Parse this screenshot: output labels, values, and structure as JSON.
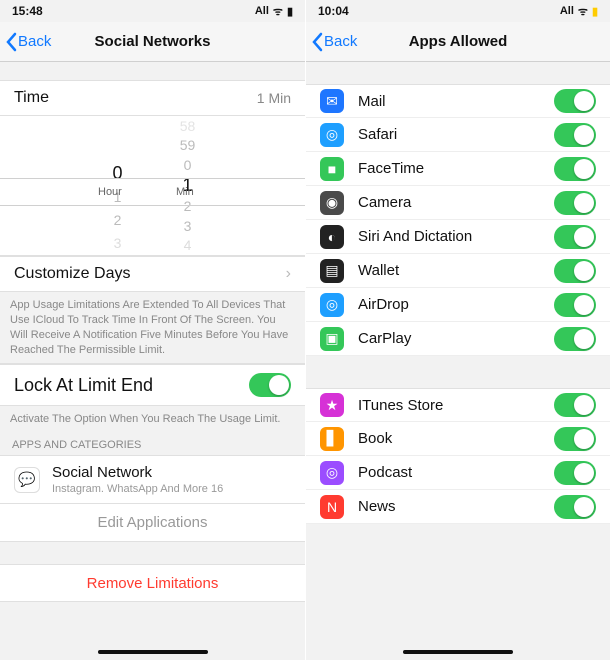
{
  "left": {
    "status": {
      "time": "15:48",
      "carrier": "All"
    },
    "nav": {
      "back": "Back",
      "title": "Social Networks"
    },
    "timeRow": {
      "label": "Time",
      "value": "1 Min"
    },
    "picker": {
      "hours": [
        "",
        "",
        "0",
        "1",
        "2",
        "3"
      ],
      "mins": [
        "58",
        "59",
        "0",
        "1",
        "2",
        "3",
        "4"
      ],
      "selHour": "0",
      "selMin": "1",
      "hourUnit": "Hour",
      "minUnit": "Min"
    },
    "customize": "Customize Days",
    "note1": "App Usage Limitations Are Extended To All Devices That Use ICloud To Track Time In Front Of The Screen. You Will Receive A Notification Five Minutes Before You Have Reached The Permissible Limit.",
    "lockRow": "Lock At Limit End",
    "note2": "Activate The Option When You Reach The Usage Limit.",
    "catHead": "APPS AND CATEGORIES",
    "category": {
      "name": "Social Network",
      "sub": "Instagram. WhatsApp And More 16",
      "icon": "💬"
    },
    "editBtn": "Edit Applications",
    "removeBtn": "Remove Limitations"
  },
  "right": {
    "status": {
      "time": "10:04",
      "carrier": "All"
    },
    "nav": {
      "back": "Back",
      "title": "Apps Allowed"
    },
    "group1": [
      {
        "key": "mail",
        "name": "Mail",
        "bg": "#1e76ff",
        "glyph": "✉"
      },
      {
        "key": "safari",
        "name": "Safari",
        "bg": "#1e9fff",
        "glyph": "◎"
      },
      {
        "key": "facetime",
        "name": "FaceTime",
        "bg": "#34c759",
        "glyph": "■"
      },
      {
        "key": "camera",
        "name": "Camera",
        "bg": "#4a4a4a",
        "glyph": "◉"
      },
      {
        "key": "siri",
        "name": "Siri And Dictation",
        "bg": "#222",
        "glyph": "◐"
      },
      {
        "key": "wallet",
        "name": "Wallet",
        "bg": "#222",
        "glyph": "▤"
      },
      {
        "key": "airdrop",
        "name": "AirDrop",
        "bg": "#1e9fff",
        "glyph": "◎"
      },
      {
        "key": "carplay",
        "name": "CarPlay",
        "bg": "#34c759",
        "glyph": "▣"
      }
    ],
    "group2": [
      {
        "key": "itunes",
        "name": "ITunes Store",
        "bg": "#d631d6",
        "glyph": "★"
      },
      {
        "key": "book",
        "name": "Book",
        "bg": "#ff9500",
        "glyph": "▋"
      },
      {
        "key": "podcast",
        "name": "Podcast",
        "bg": "#9b4dff",
        "glyph": "◎"
      },
      {
        "key": "news",
        "name": "News",
        "bg": "#ff3b30",
        "glyph": "N"
      }
    ]
  }
}
